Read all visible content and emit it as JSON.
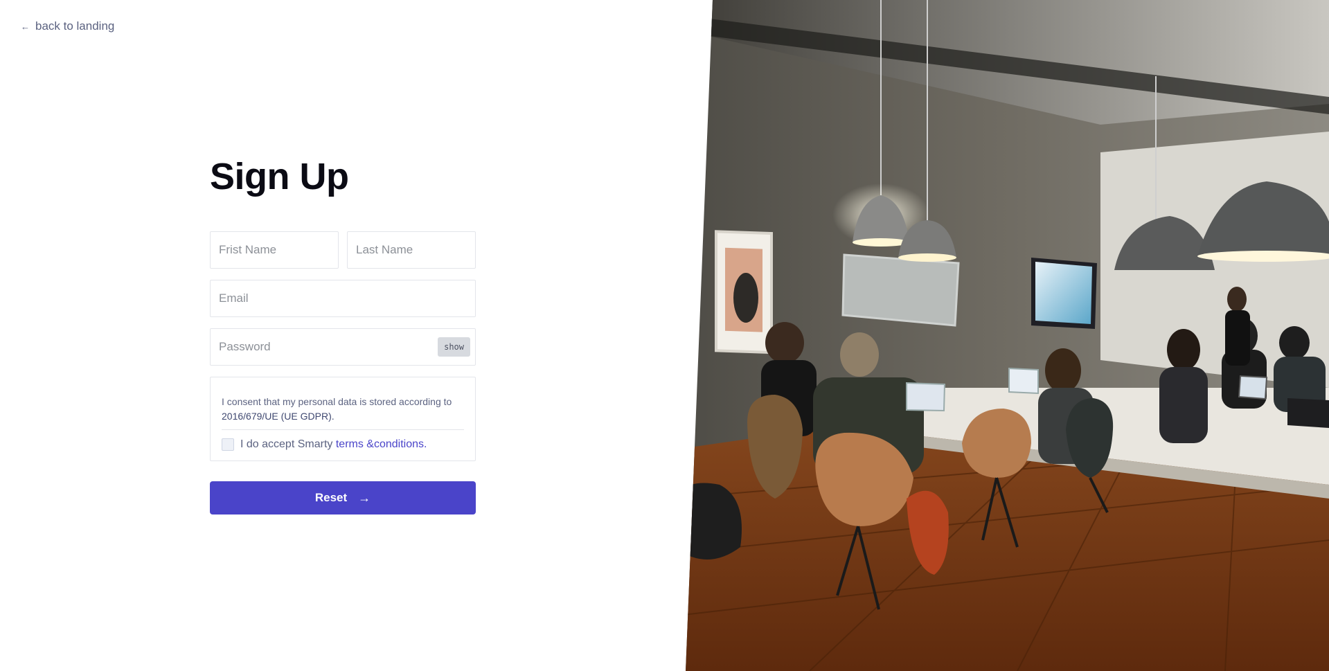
{
  "nav": {
    "back_label": "back to landing",
    "back_icon": "arrow-left-icon"
  },
  "form": {
    "title": "Sign Up",
    "first_name_placeholder": "Frist Name",
    "last_name_placeholder": "Last Name",
    "email_placeholder": "Email",
    "password_placeholder": "Password",
    "show_label": "show",
    "consent_prefix": "I consent that my personal data is stored according to ",
    "consent_regulation": "2016/679/UE (UE GDPR).",
    "accept_prefix": "I do accept Smarty ",
    "accept_link": "terms &conditions.",
    "submit_label": "Reset",
    "submit_icon": "arrow-right-icon"
  },
  "colors": {
    "accent": "#4a44c9",
    "muted_text": "#5b6280",
    "border": "#e3e5ea"
  },
  "photo": {
    "description_icon": "classroom-photo"
  }
}
